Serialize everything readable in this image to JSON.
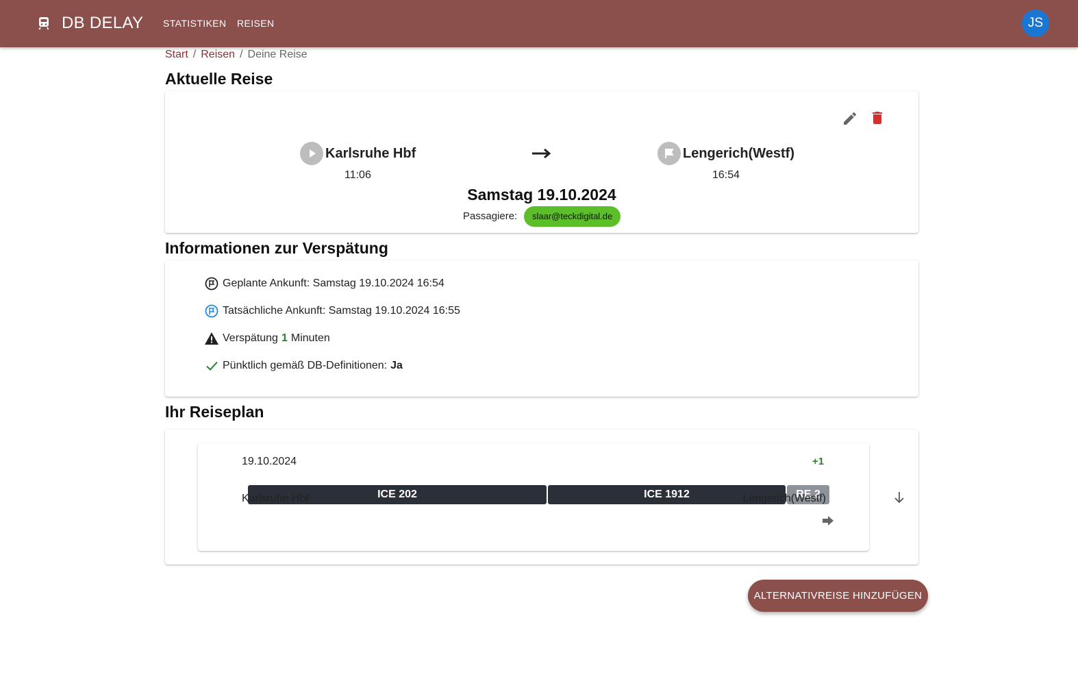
{
  "appbar": {
    "brand_icon": "train-icon",
    "title": "DB DELAY",
    "nav": [
      "STATISTIKEN",
      "REISEN"
    ],
    "avatar_initials": "JS",
    "color": "#8b4f4c"
  },
  "breadcrumb": {
    "items": [
      "Start",
      "Reisen"
    ],
    "separator": "/",
    "current": "Deine Reise"
  },
  "current_trip": {
    "heading": "Aktuelle Reise",
    "from": {
      "name": "Karlsruhe Hbf",
      "time": "11:06",
      "icon": "play-circle-icon"
    },
    "to": {
      "name": "Lengerich(Westf)",
      "time": "16:54",
      "icon": "flag-circle-icon"
    },
    "arrow_icon": "arrow-right-icon",
    "date": "Samstag 19.10.2024",
    "passengers_label": "Passagiere:",
    "passengers": [
      "slaar@teckdigital.de"
    ],
    "actions": {
      "edit_icon": "edit-icon",
      "delete_icon": "delete-icon"
    }
  },
  "delay_info": {
    "heading": "Informationen zur Verspätung",
    "planned": "Geplante Ankunft: Samstag 19.10.2024 16:54",
    "actual": "Tatsächliche Ankunft: Samstag 19.10.2024 16:55",
    "delay_prefix": "Verspätung",
    "delay_minutes": "1",
    "delay_suffix": "Minuten",
    "punctual_label": "Pünktlich gemäß DB-Definitionen:",
    "punctual_value": "Ja"
  },
  "plan": {
    "heading": "Ihr Reiseplan",
    "date": "19.10.2024",
    "delay": "+1",
    "segments": [
      {
        "label": "ICE 202",
        "color": "#2b2f38",
        "share": 0.515
      },
      {
        "label": "ICE 1912",
        "color": "#2b2f38",
        "share": 0.41
      },
      {
        "label": "RE 2",
        "color": "#8e939a",
        "share": 0.075
      }
    ],
    "from": "Karlsruhe Hbf",
    "to": "Lengerich(Westf)",
    "expand_icon": "arrow-down-icon",
    "forward_icon": "arrow-forward-icon"
  },
  "fab": {
    "label": "ALTERNATIVREISE HINZUFÜGEN"
  }
}
